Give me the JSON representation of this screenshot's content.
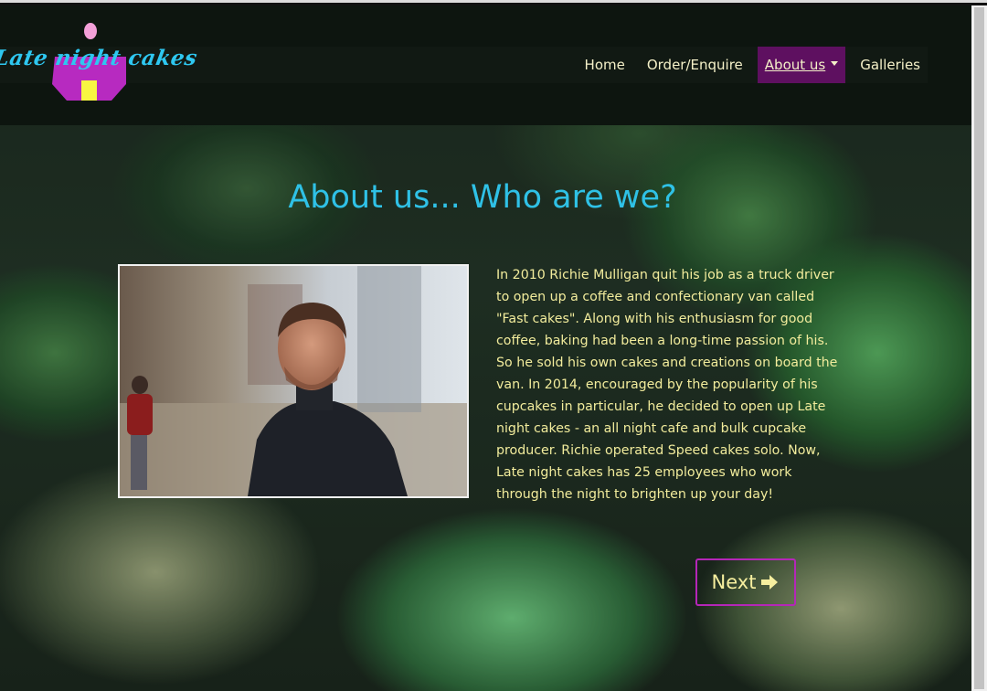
{
  "logo": {
    "text": "Late night cakes"
  },
  "nav": {
    "items": [
      {
        "label": "Home"
      },
      {
        "label": "Order/Enquire"
      },
      {
        "label": "About us"
      },
      {
        "label": "Galleries"
      }
    ],
    "active_index": 2
  },
  "main": {
    "title": "About us... Who are we?",
    "photo_icon": "portrait-photo",
    "paragraph": "In 2010 Richie Mulligan quit his job as a truck driver to open up a coffee and confectionary van called \"Fast cakes\". Along with his enthusiasm for good coffee, baking had been a long-time passion of his. So he sold his own cakes and creations on board the van. In 2014, encouraged by the popularity of his cupcakes in particular, he decided to open up Late night cakes - an all night cafe and bulk cupcake producer. Richie operated Speed cakes solo. Now, Late night cakes has 25 employees who work through the night to brighten up your day!",
    "next_label": "Next",
    "next_icon": "arrow-right-icon"
  },
  "colors": {
    "title": "#2fc1e6",
    "body_text": "#f2ec9c",
    "nav_active_bg": "#5e1060",
    "button_border": "#b526b8",
    "header_bg": "#0d150f"
  }
}
